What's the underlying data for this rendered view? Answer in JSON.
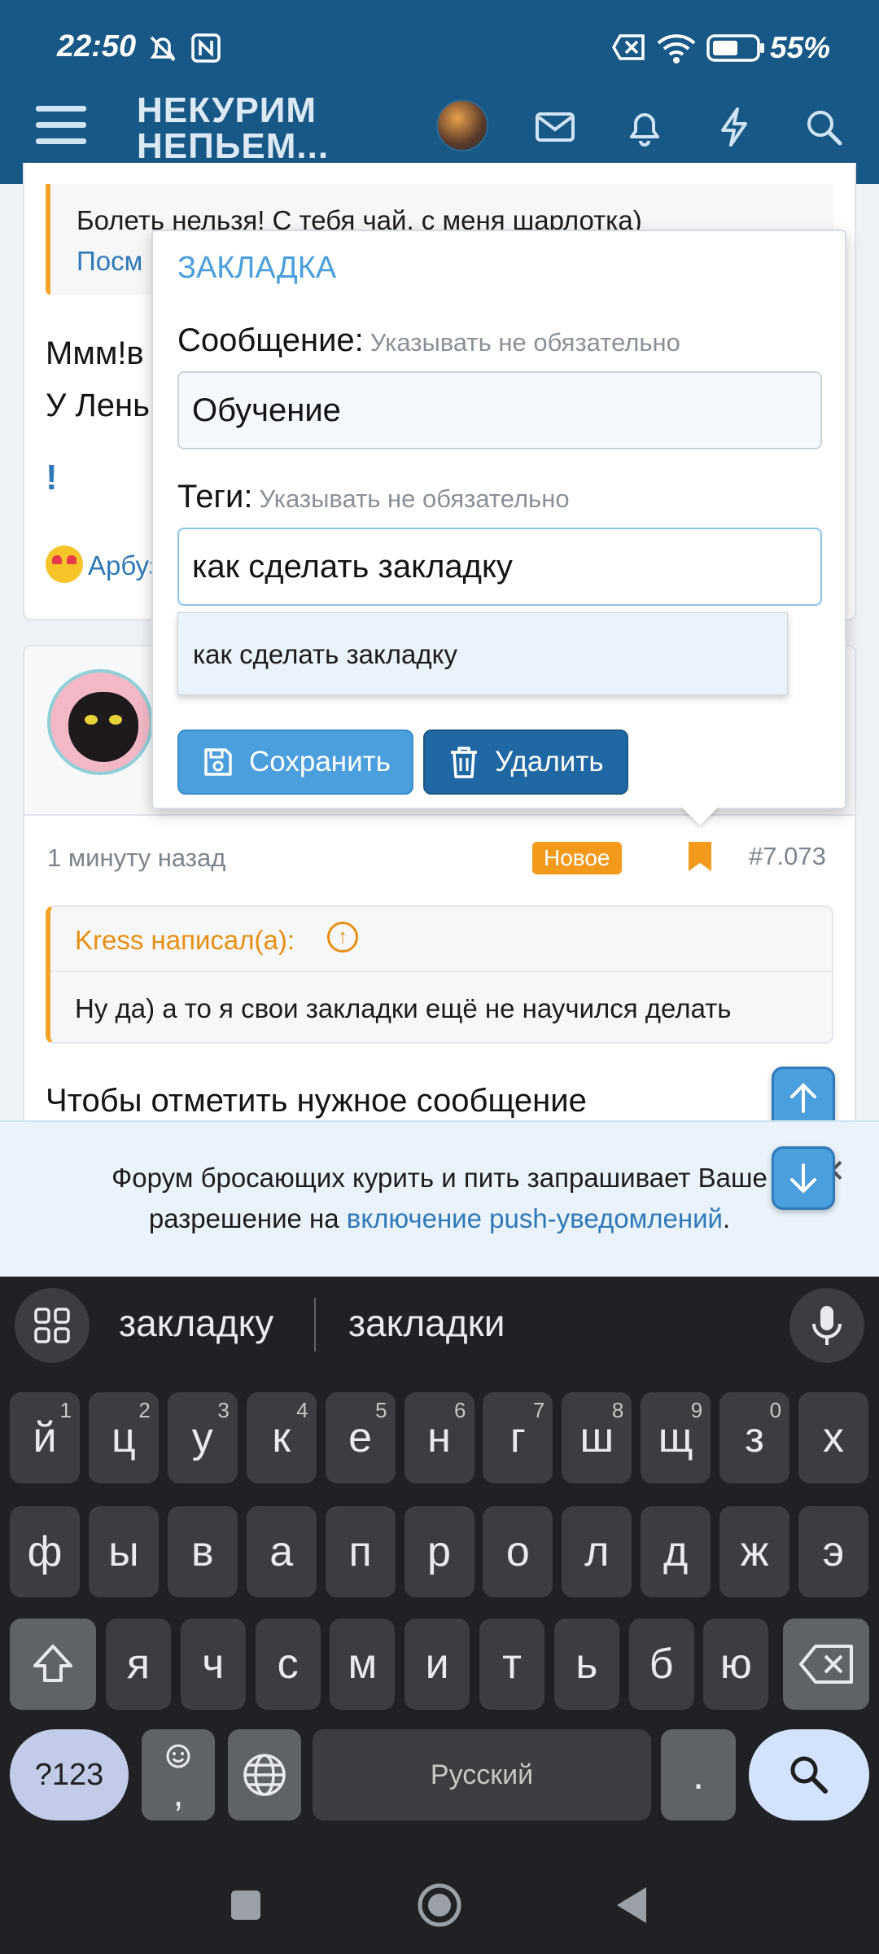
{
  "status_bar": {
    "time": "22:50",
    "battery": "55%"
  },
  "header": {
    "logo_line1": "НЕКУРИМ",
    "logo_line2": "НЕПЬЕМ..."
  },
  "background_post": {
    "quote_text": "Болеть нельзя! С тебя чай, с меня шарлотка)",
    "quote_more": "Посм",
    "text_line1": "Ммм!в",
    "text_line2": "У Лень",
    "exclamation": "!",
    "reaction_user": "Арбуз"
  },
  "post": {
    "time": "1 минуту назад",
    "badge": "Новое",
    "number": "#7.073",
    "quote_author": "Kress написал(а):",
    "quote_text": "Ну да) а то я свои закладки ещё не научился делать",
    "body_start": "Чтобы отметить нужное сообщение"
  },
  "bookmark_popup": {
    "title": "ЗАКЛАДКА",
    "message_label": "Сообщение:",
    "message_hint": "Указывать не обязательно",
    "message_value": "Обучение",
    "tags_label": "Теги:",
    "tags_hint": "Указывать не обязательно",
    "tags_value": "как сделать закладку",
    "suggestion": "как сделать закладку",
    "save_label": "Сохранить",
    "delete_label": "Удалить"
  },
  "push_notice": {
    "text_before": "Форум бросающих курить и пить запрашивает Ваше разрешение на",
    "link_text": "включение push-уведомлений",
    "text_after": ".",
    "close": "✕"
  },
  "keyboard": {
    "suggestions": [
      "закладку",
      "закладки"
    ],
    "row1": [
      {
        "k": "й",
        "n": "1"
      },
      {
        "k": "ц",
        "n": "2"
      },
      {
        "k": "у",
        "n": "3"
      },
      {
        "k": "к",
        "n": "4"
      },
      {
        "k": "е",
        "n": "5"
      },
      {
        "k": "н",
        "n": "6"
      },
      {
        "k": "г",
        "n": "7"
      },
      {
        "k": "ш",
        "n": "8"
      },
      {
        "k": "щ",
        "n": "9"
      },
      {
        "k": "з",
        "n": "0"
      },
      {
        "k": "х",
        "n": ""
      }
    ],
    "row2": [
      "ф",
      "ы",
      "в",
      "а",
      "п",
      "р",
      "о",
      "л",
      "д",
      "ж",
      "э"
    ],
    "row3": [
      "я",
      "ч",
      "с",
      "м",
      "и",
      "т",
      "ь",
      "б",
      "ю"
    ],
    "sym_label": "?123",
    "emoji_comma": ",",
    "space_label": "Русский",
    "period": "."
  },
  "icons": [
    "hamburger-icon",
    "mail-icon",
    "bell-icon",
    "bolt-icon",
    "search-icon",
    "save-icon",
    "trash-icon",
    "bookmark-icon",
    "arrow-up-icon",
    "arrow-down-icon",
    "mic-icon",
    "globe-icon",
    "shift-icon",
    "backspace-icon"
  ],
  "colors": {
    "header": "#185886",
    "accent": "#4a9fdc",
    "orange": "#f39a1c",
    "delete_button": "#1f68a3"
  }
}
